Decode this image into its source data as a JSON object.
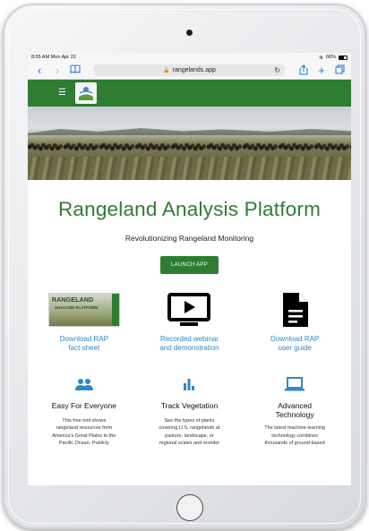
{
  "status_bar": {
    "time": "8:55 AM",
    "date": "Mon Apr 22",
    "battery": "66%"
  },
  "browser": {
    "url": "rangelands.app"
  },
  "colors": {
    "brand_green": "#2e7d32",
    "link_blue": "#2e89c9",
    "icon_blue": "#2e89c9"
  },
  "hero": {
    "title": "Rangeland Analysis Platform",
    "tagline": "Revolutionizing Rangeland Monitoring",
    "launch_label": "LAUNCH APP"
  },
  "resources": [
    {
      "label": "Download RAP\nfact sheet",
      "icon": "fact-sheet-thumbnail",
      "thumb_title": "RANGELAND",
      "thumb_subtitle": "ANALYSIS PLATFORM"
    },
    {
      "label": "Recorded webinar\nand demonstration",
      "icon": "video-player-icon"
    },
    {
      "label": "Download RAP\nuser guide",
      "icon": "document-icon"
    }
  ],
  "features": [
    {
      "title": "Easy For Everyone",
      "icon": "people-icon",
      "description": "This free tool shows\nrangeland resources from\nAmerica's Great Plains to the\nPacific Ocean. Publicly"
    },
    {
      "title": "Track Vegetation",
      "icon": "bar-chart-icon",
      "description": "See the types of plants\ncovering U.S. rangelands at\npasture, landscape, or\nregional scales and monitor"
    },
    {
      "title": "Advanced\nTechnology",
      "icon": "laptop-icon",
      "description": "The latest machine-learning\ntechnology combines\nthousands of ground-based"
    }
  ]
}
